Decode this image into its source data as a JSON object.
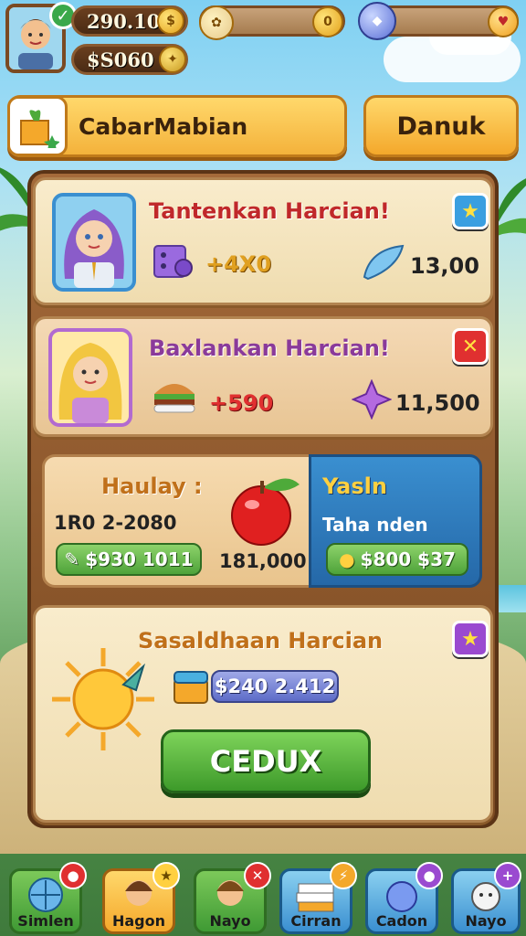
{
  "hud": {
    "coins_value": "290.10",
    "cash_value": "$S060",
    "check_icon": "check-icon",
    "coin_icon": "coin-icon",
    "gem_icon": "gem-icon"
  },
  "header": {
    "title": "CabarMabian",
    "action_label": "Danuk"
  },
  "quests": [
    {
      "title": "Tantenkan Harcian!",
      "reward_value": "+4X0",
      "secondary_value": "13,00",
      "corner_icon": "star-icon",
      "title_color": "#c0282a"
    },
    {
      "title": "Baxlankan Harcian!",
      "reward_value": "+590",
      "secondary_value": "11,500",
      "corner_icon": "close-icon",
      "title_color": "#8a3a9a"
    }
  ],
  "split": {
    "left_title": "Haulay :",
    "left_subtitle": "1R0 2-2080",
    "left_pill": "$930 1011",
    "center_value": "181,000",
    "right_title": "Yasln",
    "right_subtitle": "Taha nden",
    "right_pill": "$800 $37"
  },
  "daily": {
    "title": "Sasaldhaan Harcian",
    "pill_value": "$240 2.412",
    "button_label": "CEDUX"
  },
  "nav": [
    {
      "label": "Simlen"
    },
    {
      "label": "Hagon"
    },
    {
      "label": "Nayo"
    },
    {
      "label": "Cirran"
    },
    {
      "label": "Cadon"
    },
    {
      "label": "Nayo"
    }
  ],
  "colors": {
    "accent": "#f4b23b",
    "primary_green": "#3d9a2a",
    "panel_blue": "#2568a8"
  }
}
